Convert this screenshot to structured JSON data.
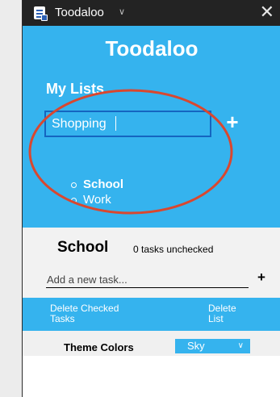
{
  "window": {
    "title": "Toodaloo"
  },
  "app": {
    "title": "Toodaloo"
  },
  "my_lists": {
    "heading": "My Lists",
    "new_list_input_value": "Shopping",
    "add_button_label": "+",
    "items": [
      {
        "label": "School",
        "active": true
      },
      {
        "label": "Work",
        "active": false
      }
    ]
  },
  "current_list": {
    "title": "School",
    "count_text": "0 tasks unchecked",
    "task_placeholder": "Add a new task...",
    "add_button_label": "+"
  },
  "actions": {
    "delete_checked_line1": "Delete Checked",
    "delete_checked_line2": "Tasks",
    "delete_list_line1": "Delete",
    "delete_list_line2": "List"
  },
  "theme": {
    "label": "Theme Colors",
    "selected": "Sky"
  },
  "colors": {
    "primary": "#35b3ee",
    "focus_border": "#1565c0",
    "titlebar": "#232323",
    "annotation": "#d9472f"
  },
  "icons": {
    "app": "notepad-icon",
    "window_chevron": "chevron-down-icon",
    "close": "close-icon",
    "select_chevron": "chevron-down-icon"
  }
}
